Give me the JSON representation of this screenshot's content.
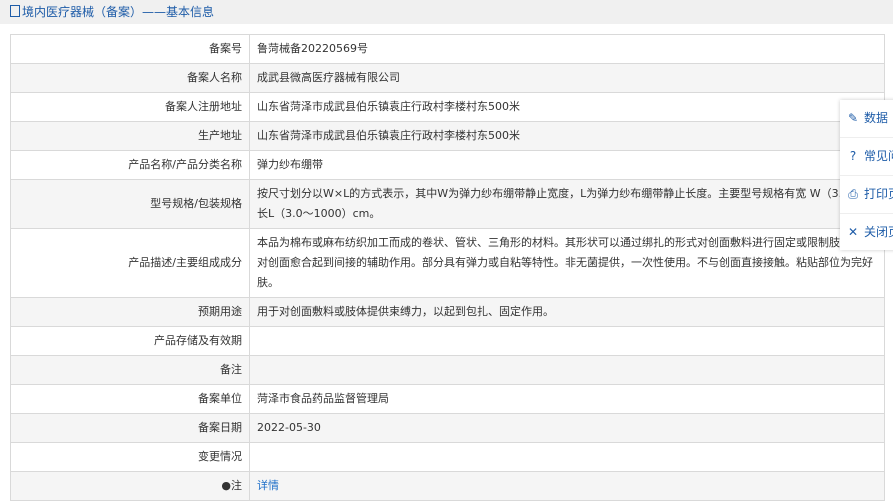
{
  "header": {
    "title": "境内医疗器械（备案）——基本信息"
  },
  "rows": [
    {
      "label": "备案号",
      "value": "鲁菏械备20220569号"
    },
    {
      "label": "备案人名称",
      "value": "成武县微高医疗器械有限公司"
    },
    {
      "label": "备案人注册地址",
      "value": "山东省菏泽市成武县伯乐镇袁庄行政村李楼村东500米"
    },
    {
      "label": "生产地址",
      "value": "山东省菏泽市成武县伯乐镇袁庄行政村李楼村东500米"
    },
    {
      "label": "产品名称/产品分类名称",
      "value": "弹力纱布绷带"
    },
    {
      "label": "型号规格/包装规格",
      "value": "按尺寸划分以W×L的方式表示，其中W为弹力纱布绷带静止宽度，L为弹力纱布绷带静止长度。主要型号规格有宽 W（3.0～25 长L（3.0～1000）cm。"
    },
    {
      "label": "产品描述/主要组成成分",
      "value": "本品为棉布或麻布纺织加工而成的卷状、管状、三角形的材料。其形状可以通过绑扎的形式对创面敷料进行固定或限制肢体活动 对创面愈合起到间接的辅助作用。部分具有弹力或自粘等特性。非无菌提供，一次性使用。不与创面直接接触。粘贴部位为完好 肤。"
    },
    {
      "label": "预期用途",
      "value": "用于对创面敷料或肢体提供束缚力，以起到包扎、固定作用。"
    },
    {
      "label": "产品存储及有效期",
      "value": ""
    },
    {
      "label": "备注",
      "value": ""
    },
    {
      "label": "备案单位",
      "value": "菏泽市食品药品监督管理局"
    },
    {
      "label": "备案日期",
      "value": "2022-05-30"
    },
    {
      "label": "变更情况",
      "value": ""
    },
    {
      "label": "注",
      "value": "详情"
    }
  ],
  "panel": [
    {
      "icon": "edit-icon",
      "label": "数据"
    },
    {
      "icon": "question-icon",
      "label": "常见问"
    },
    {
      "icon": "print-icon",
      "label": "打印页"
    },
    {
      "icon": "close-icon",
      "label": "关闭页"
    }
  ]
}
